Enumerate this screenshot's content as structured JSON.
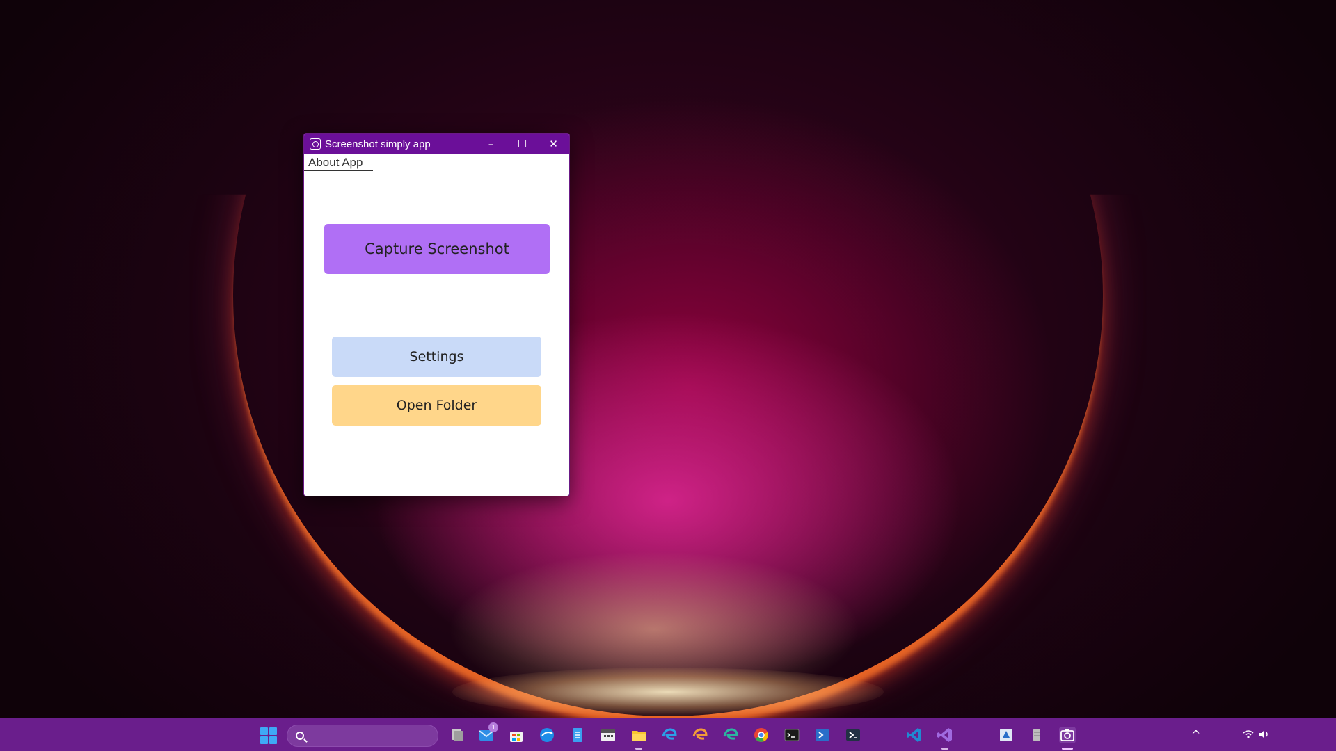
{
  "window": {
    "title": "Screenshot simply app",
    "minimize_glyph": "–",
    "maximize_glyph": "☐",
    "close_glyph": "✕"
  },
  "menu": {
    "about_label": "About App"
  },
  "buttons": {
    "capture_label": "Capture Screenshot",
    "settings_label": "Settings",
    "open_folder_label": "Open Folder"
  },
  "colors": {
    "titlebar": "#6b0f99",
    "capture_button": "#b06ff5",
    "settings_button": "#c9daf8",
    "open_folder_button": "#ffd68a",
    "taskbar": "#6a1e8c"
  },
  "taskbar": {
    "mail_badge": "1",
    "tray_chevron": "^",
    "apps": [
      "task-view-icon",
      "mail-icon",
      "store-icon",
      "browser-icon",
      "notepad-icon",
      "calendar-icon",
      "file-explorer-icon",
      "edge-icon",
      "edge-beta-icon",
      "edge-dev-icon",
      "chrome-icon",
      "terminal-icon",
      "powershell-icon",
      "powershell-core-icon",
      "vscode-icon",
      "visual-studio-icon",
      "installer-icon",
      "database-icon",
      "screenshot-app-icon"
    ]
  }
}
